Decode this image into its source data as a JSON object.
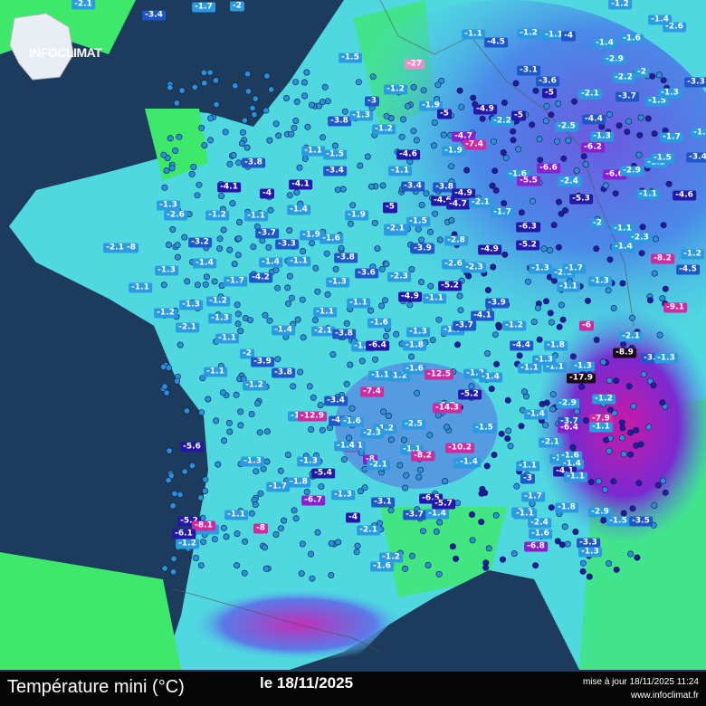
{
  "footer": {
    "title": "Température mini (°C)",
    "date": "le 18/11/2025",
    "update": "mise à jour 18/11/2025 11:24",
    "site": "www.infoclimat.fr"
  },
  "logo": {
    "text": "INFOCLIMAT"
  },
  "colors": {
    "sea": "#1d3b5c",
    "land_green": "#3de86a",
    "cyan": "#4fd8e0",
    "blue_station": "#2a9be0",
    "dark_blue": "#2418a8",
    "purple": "#8a1fd0",
    "magenta": "#d02aa0"
  },
  "stations": [
    {
      "v": "-3.4",
      "c": 2
    },
    {
      "v": "-1.7",
      "c": 1
    },
    {
      "v": "-2",
      "c": 1
    },
    {
      "v": "-2.1",
      "c": 1
    },
    {
      "v": "-1.2",
      "c": 1
    },
    {
      "v": "-1.4",
      "c": 1
    },
    {
      "v": "-2.6",
      "c": 1
    },
    {
      "v": "-1.1",
      "c": 1
    },
    {
      "v": "-4.5",
      "c": 2
    },
    {
      "v": "-1.2",
      "c": 1
    },
    {
      "v": "-1.1",
      "c": 1
    },
    {
      "v": "-4",
      "c": 2
    },
    {
      "v": "-1.4",
      "c": 1
    },
    {
      "v": "-1.6",
      "c": 1
    },
    {
      "v": "-27",
      "c": 7
    },
    {
      "v": "-3.1",
      "c": 2
    },
    {
      "v": "-2.9",
      "c": 1
    },
    {
      "v": "-2.2",
      "c": 1
    },
    {
      "v": "-2",
      "c": 1
    },
    {
      "v": "-3.3",
      "c": 2
    },
    {
      "v": "-3.6",
      "c": 2
    },
    {
      "v": "-1.5",
      "c": 1
    },
    {
      "v": "-1.2",
      "c": 1
    },
    {
      "v": "-3",
      "c": 2
    },
    {
      "v": "-5",
      "c": 3
    },
    {
      "v": "-2.1",
      "c": 1
    },
    {
      "v": "-3.7",
      "c": 2
    },
    {
      "v": "-1.5",
      "c": 1
    },
    {
      "v": "-1.3",
      "c": 1
    },
    {
      "v": "-1.9",
      "c": 1
    },
    {
      "v": "-5",
      "c": 3
    },
    {
      "v": "-4.9",
      "c": 3
    },
    {
      "v": "-2.2",
      "c": 1
    },
    {
      "v": "-5",
      "c": 3
    },
    {
      "v": "-3.8",
      "c": 2
    },
    {
      "v": "-1.3",
      "c": 1
    },
    {
      "v": "-1.2",
      "c": 1
    },
    {
      "v": "-4.7",
      "c": 4
    },
    {
      "v": "-7.4",
      "c": 5
    },
    {
      "v": "-2.5",
      "c": 1
    },
    {
      "v": "-4.4",
      "c": 2
    },
    {
      "v": "-6.2",
      "c": 4
    },
    {
      "v": "-1.3",
      "c": 1
    },
    {
      "v": "-1.7",
      "c": 1
    },
    {
      "v": "-1.2",
      "c": 1
    },
    {
      "v": "-4.6",
      "c": 3
    },
    {
      "v": "-1.9",
      "c": 1
    },
    {
      "v": "-1.1",
      "c": 1
    },
    {
      "v": "-1.5",
      "c": 1
    },
    {
      "v": "-3.8",
      "c": 2
    },
    {
      "v": "-3.4",
      "c": 2
    },
    {
      "v": "-1.1",
      "c": 1
    },
    {
      "v": "-1.6",
      "c": 1
    },
    {
      "v": "-6.6",
      "c": 4
    },
    {
      "v": "-6.6",
      "c": 4
    },
    {
      "v": "-2.4",
      "c": 1
    },
    {
      "v": "-2.9",
      "c": 1
    },
    {
      "v": "-1.2",
      "c": 1
    },
    {
      "v": "-1.5",
      "c": 1
    },
    {
      "v": "-3.4",
      "c": 2
    },
    {
      "v": "-4.1",
      "c": 3
    },
    {
      "v": "-4",
      "c": 3
    },
    {
      "v": "-4.1",
      "c": 3
    },
    {
      "v": "-3.4",
      "c": 2
    },
    {
      "v": "-3.8",
      "c": 2
    },
    {
      "v": "-4.9",
      "c": 3
    },
    {
      "v": "-5",
      "c": 3
    },
    {
      "v": "-4.6",
      "c": 3
    },
    {
      "v": "-4.7",
      "c": 3
    },
    {
      "v": "-2.1",
      "c": 1
    },
    {
      "v": "-1.7",
      "c": 1
    },
    {
      "v": "-5.5",
      "c": 4
    },
    {
      "v": "-2.4",
      "c": 1
    },
    {
      "v": "-6.3",
      "c": 3
    },
    {
      "v": "-1.1",
      "c": 1
    },
    {
      "v": "-5.3",
      "c": 3
    },
    {
      "v": "-4.6",
      "c": 3
    },
    {
      "v": "-1.3",
      "c": 1
    },
    {
      "v": "-2.6",
      "c": 1
    },
    {
      "v": "-1.2",
      "c": 1
    },
    {
      "v": "-1.1",
      "c": 1
    },
    {
      "v": "-1.4",
      "c": 1
    },
    {
      "v": "-1.9",
      "c": 1
    },
    {
      "v": "-5",
      "c": 3
    },
    {
      "v": "-2.1",
      "c": 1
    },
    {
      "v": "-1.5",
      "c": 1
    },
    {
      "v": "-3.9",
      "c": 2
    },
    {
      "v": "-6.3",
      "c": 3
    },
    {
      "v": "-2",
      "c": 1
    },
    {
      "v": "-1.1",
      "c": 1
    },
    {
      "v": "-5.2",
      "c": 3
    },
    {
      "v": "-1.4",
      "c": 1
    },
    {
      "v": "-2.3",
      "c": 1
    },
    {
      "v": "-1.2",
      "c": 1
    },
    {
      "v": "-2.1",
      "c": 1
    },
    {
      "v": "-8",
      "c": 1
    },
    {
      "v": "-3.7",
      "c": 2
    },
    {
      "v": "-3.3",
      "c": 2
    },
    {
      "v": "-1.9",
      "c": 1
    },
    {
      "v": "-1.6",
      "c": 1
    },
    {
      "v": "-3.2",
      "c": 2
    },
    {
      "v": "-2.1",
      "c": 1
    },
    {
      "v": "-3.9",
      "c": 2
    },
    {
      "v": "-2.8",
      "c": 1
    },
    {
      "v": "-4.9",
      "c": 3
    },
    {
      "v": "-8.2",
      "c": 5
    },
    {
      "v": "-2.3",
      "c": 1
    },
    {
      "v": "-1.3",
      "c": 1
    },
    {
      "v": "-1.4",
      "c": 1
    },
    {
      "v": "-1.4",
      "c": 1
    },
    {
      "v": "-1.1",
      "c": 1
    },
    {
      "v": "-3.8",
      "c": 2
    },
    {
      "v": "-2.6",
      "c": 1
    },
    {
      "v": "-2.3",
      "c": 1
    },
    {
      "v": "-1.3",
      "c": 1
    },
    {
      "v": "-2.1",
      "c": 1
    },
    {
      "v": "-1.7",
      "c": 1
    },
    {
      "v": "-4.5",
      "c": 2
    },
    {
      "v": "-4.2",
      "c": 2
    },
    {
      "v": "-3.6",
      "c": 2
    },
    {
      "v": "-2.3",
      "c": 1
    },
    {
      "v": "-5.2",
      "c": 3
    },
    {
      "v": "-1.1",
      "c": 1
    },
    {
      "v": "-1.7",
      "c": 1
    },
    {
      "v": "-1.3",
      "c": 1
    },
    {
      "v": "-1.2",
      "c": 1
    },
    {
      "v": "-1.3",
      "c": 1
    },
    {
      "v": "-4.9",
      "c": 3
    },
    {
      "v": "-1.1",
      "c": 1
    },
    {
      "v": "-3.9",
      "c": 2
    },
    {
      "v": "-1.3",
      "c": 1
    },
    {
      "v": "-1.1",
      "c": 1
    },
    {
      "v": "-9.1",
      "c": 5
    },
    {
      "v": "-1.2",
      "c": 1
    },
    {
      "v": "-2.1",
      "c": 1
    },
    {
      "v": "-1.3",
      "c": 1
    },
    {
      "v": "-2.1",
      "c": 1
    },
    {
      "v": "-4.1",
      "c": 2
    },
    {
      "v": "-1.2",
      "c": 1
    },
    {
      "v": "-1.1",
      "c": 1
    },
    {
      "v": "-6",
      "c": 5
    },
    {
      "v": "-1.1",
      "c": 1
    },
    {
      "v": "-1.6",
      "c": 1
    },
    {
      "v": "-1.3",
      "c": 1
    },
    {
      "v": "-1.7",
      "c": 1
    },
    {
      "v": "-3.7",
      "c": 2
    },
    {
      "v": "-4.4",
      "c": 2
    },
    {
      "v": "-1.8",
      "c": 1
    },
    {
      "v": "-1.1",
      "c": 1
    },
    {
      "v": "-2",
      "c": 1
    },
    {
      "v": "-1.1",
      "c": 1
    },
    {
      "v": "-1.4",
      "c": 1
    },
    {
      "v": "-3.8",
      "c": 2
    },
    {
      "v": "-1.4",
      "c": 1
    },
    {
      "v": "-6.4",
      "c": 3
    },
    {
      "v": "-1.8",
      "c": 1
    },
    {
      "v": "-8.9",
      "c": 6
    },
    {
      "v": "-2.1",
      "c": 1
    },
    {
      "v": "-1.3",
      "c": 1
    },
    {
      "v": "-3.4",
      "c": 2
    },
    {
      "v": "-1.2",
      "c": 1
    },
    {
      "v": "-1.3",
      "c": 1
    },
    {
      "v": "-3.9",
      "c": 2
    },
    {
      "v": "-3.8",
      "c": 2
    },
    {
      "v": "-1.1",
      "c": 1
    },
    {
      "v": "-1.6",
      "c": 1
    },
    {
      "v": "-12.5",
      "c": 5
    },
    {
      "v": "-1.2",
      "c": 1
    },
    {
      "v": "-1.4",
      "c": 1
    },
    {
      "v": "-1.1",
      "c": 1
    },
    {
      "v": "-1.3",
      "c": 1
    },
    {
      "v": "-17.9",
      "c": 6
    },
    {
      "v": "-1.1",
      "c": 1
    },
    {
      "v": "-1.2",
      "c": 1
    },
    {
      "v": "-3.4",
      "c": 2
    },
    {
      "v": "-7.4",
      "c": 5
    },
    {
      "v": "-1.7",
      "c": 1
    },
    {
      "v": "-1.2",
      "c": 1
    },
    {
      "v": "-2.9",
      "c": 1
    },
    {
      "v": "-3.7",
      "c": 2
    },
    {
      "v": "-5.2",
      "c": 3
    },
    {
      "v": "-7.9",
      "c": 5
    },
    {
      "v": "-4.1",
      "c": 2
    },
    {
      "v": "-1.1",
      "c": 1
    },
    {
      "v": "-14.3",
      "c": 5
    },
    {
      "v": "-12.9",
      "c": 5
    },
    {
      "v": "-1.6",
      "c": 1
    },
    {
      "v": "-1.2",
      "c": 1
    },
    {
      "v": "-2.5",
      "c": 1
    },
    {
      "v": "-1.5",
      "c": 1
    },
    {
      "v": "-1.4",
      "c": 1
    },
    {
      "v": "-6.4",
      "c": 4
    },
    {
      "v": "-1.1",
      "c": 1
    },
    {
      "v": "-5.6",
      "c": 3
    },
    {
      "v": "-1.1",
      "c": 1
    },
    {
      "v": "-2.3",
      "c": 1
    },
    {
      "v": "-1.4",
      "c": 1
    },
    {
      "v": "-8",
      "c": 4
    },
    {
      "v": "-1.1",
      "c": 1
    },
    {
      "v": "-5",
      "c": 5
    },
    {
      "v": "-1.4",
      "c": 1
    },
    {
      "v": "-8.2",
      "c": 5
    },
    {
      "v": "-10.2",
      "c": 5
    },
    {
      "v": "-2.1",
      "c": 1
    },
    {
      "v": "-1.6",
      "c": 1
    },
    {
      "v": "-1.3",
      "c": 1
    },
    {
      "v": "-1.3",
      "c": 1
    },
    {
      "v": "-2.1",
      "c": 1
    },
    {
      "v": "-1.1",
      "c": 1
    },
    {
      "v": "-1.6",
      "c": 1
    },
    {
      "v": "-1.4",
      "c": 1
    },
    {
      "v": "-5.4",
      "c": 3
    },
    {
      "v": "-1.4",
      "c": 1
    },
    {
      "v": "-1.1",
      "c": 1
    },
    {
      "v": "-4.1",
      "c": 3
    },
    {
      "v": "-1.1",
      "c": 1
    },
    {
      "v": "-1.7",
      "c": 1
    },
    {
      "v": "-1.8",
      "c": 1
    },
    {
      "v": "-6.7",
      "c": 4
    },
    {
      "v": "-1.3",
      "c": 1
    },
    {
      "v": "-3",
      "c": 2
    },
    {
      "v": "-1.7",
      "c": 1
    },
    {
      "v": "-6.5",
      "c": 3
    },
    {
      "v": "-5.7",
      "c": 3
    },
    {
      "v": "-3.1",
      "c": 2
    },
    {
      "v": "-3.7",
      "c": 2
    },
    {
      "v": "-1.4",
      "c": 1
    },
    {
      "v": "-2.4",
      "c": 1
    },
    {
      "v": "-1.8",
      "c": 1
    },
    {
      "v": "-2.9",
      "c": 1
    },
    {
      "v": "-1.1",
      "c": 1
    },
    {
      "v": "-1.7",
      "c": 1
    },
    {
      "v": "-4",
      "c": 3
    },
    {
      "v": "-2.1",
      "c": 1
    },
    {
      "v": "-1.1",
      "c": 1
    },
    {
      "v": "-2.4",
      "c": 1
    },
    {
      "v": "-1.5",
      "c": 1
    },
    {
      "v": "-3.5",
      "c": 2
    },
    {
      "v": "-5.2",
      "c": 3
    },
    {
      "v": "-8.1",
      "c": 5
    },
    {
      "v": "-1.6",
      "c": 1
    },
    {
      "v": "-8",
      "c": 5
    },
    {
      "v": "-6.1",
      "c": 3
    },
    {
      "v": "-1.2",
      "c": 1
    },
    {
      "v": "-6.8",
      "c": 4
    },
    {
      "v": "-3.3",
      "c": 2
    },
    {
      "v": "-1.3",
      "c": 1
    },
    {
      "v": "-1.2",
      "c": 1
    },
    {
      "v": "-1.6",
      "c": 1
    }
  ]
}
